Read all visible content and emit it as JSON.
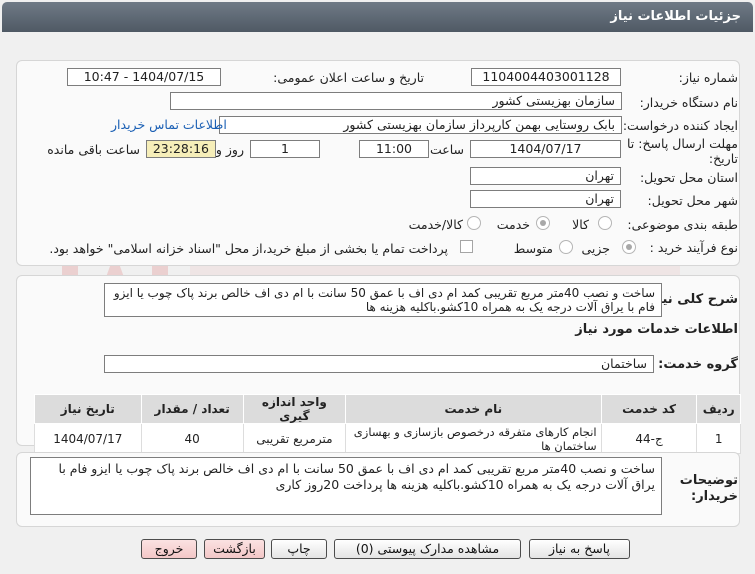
{
  "window": {
    "title": "جزئیات اطلاعات نیاز"
  },
  "colors": {
    "titlebar": "#5c6670",
    "highlight_field": "#f6eeb9",
    "link": "#1a5fb4",
    "danger_button": "#f3c7c7"
  },
  "details": {
    "need_number_label": "شماره نیاز:",
    "need_number": "1104004403001128",
    "announce_label": "تاریخ و ساعت اعلان عمومی:",
    "announce_value": "1404/07/15 - 10:47",
    "buyer_label": "نام دستگاه خریدار:",
    "buyer_value": "سازمان بهزیستی کشور",
    "creator_label": "ایجاد کننده درخواست:",
    "creator_value": "بابک  روستایی بهمن کارپرداز سازمان بهزیستی کشور",
    "contact_link": "اطلاعات تماس خریدار",
    "deadline_label_1": "مهلت ارسال پاسخ: تا",
    "deadline_label_2": "تاریخ:",
    "deadline_date": "1404/07/17",
    "time_label": "ساعت",
    "deadline_time": "11:00",
    "days_value": "1",
    "days_label": "روز و",
    "remaining_time": "23:28:16",
    "remaining_label": "ساعت باقی مانده",
    "province_label": "استان محل تحویل:",
    "province_value": "تهران",
    "city_label": "شهر محل تحویل:",
    "city_value": "تهران",
    "category_label": "طبقه بندی موضوعی:",
    "category_options": [
      "کالا",
      "خدمت",
      "کالا/خدمت"
    ],
    "category_selected": "خدمت",
    "process_label": "نوع فرآیند خرید :",
    "process_options": [
      "جزیی",
      "متوسط"
    ],
    "process_selected": "جزیی",
    "treasury_note": "پرداخت تمام یا بخشی از مبلغ خرید،از محل \"اسناد خزانه اسلامی\" خواهد بود."
  },
  "summary": {
    "label": "شرح کلی نیاز:",
    "text": "ساخت و نصب 40متر مربع تقریبی کمد ام دی اف با عمق 50 سانت با ام دی اف خالص برند پاک چوب یا ایزو فام با یراق آلات درجه یک به همراه 10کشو.باکلیه هزینه ها"
  },
  "services": {
    "section_title": "اطلاعات خدمات مورد نیاز",
    "group_label": "گروه خدمت:",
    "group_value": "ساختمان",
    "table": {
      "headers": [
        "ردیف",
        "کد خدمت",
        "نام خدمت",
        "واحد اندازه گیری",
        "تعداد / مقدار",
        "تاریخ نیاز"
      ],
      "rows": [
        [
          "1",
          "ج-44",
          "انجام کارهای متفرقه درخصوص بازسازی و بهسازی ساختمان ها",
          "مترمربع تقریبی",
          "40",
          "1404/07/17"
        ]
      ]
    }
  },
  "buyer_notes": {
    "label_1": "توضیحات",
    "label_2": "خریدار:",
    "text": "ساخت و نصب 40متر مربع تقریبی کمد ام دی اف با عمق 50 سانت با ام دی اف خالص برند پاک چوب یا ایزو فام با یراق آلات درجه یک به همراه 10کشو.باکلیه هزینه ها پرداخت 20روز کاری"
  },
  "buttons": {
    "reply": "پاسخ به نیاز",
    "view_docs": "مشاهده مدارک پیوستی (0)",
    "print": "چاپ",
    "back": "بازگشت",
    "exit": "خروج"
  }
}
